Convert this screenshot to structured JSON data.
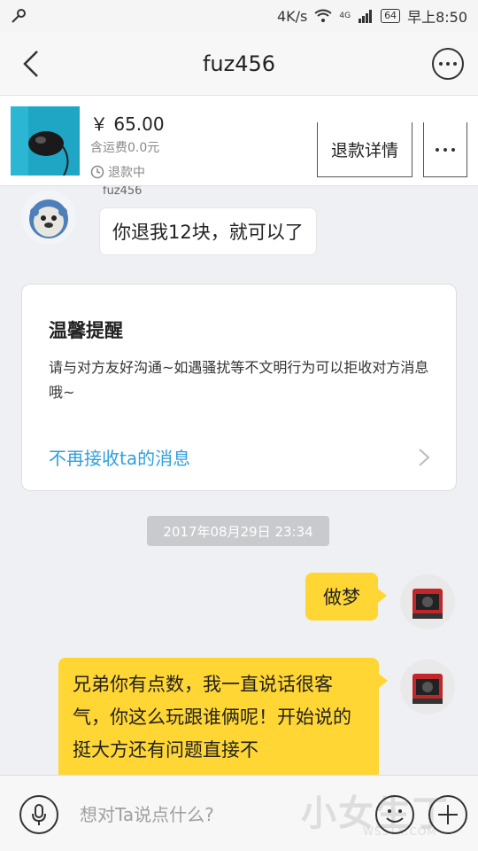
{
  "status_bar": {
    "network_speed": "4K/s",
    "signal_badge": "4G",
    "battery": "64",
    "time": "早上8:50"
  },
  "nav": {
    "title": "fuz456"
  },
  "product": {
    "price": "￥ 65.00",
    "shipping": "含运费0.0元",
    "status": "退款中",
    "refund_detail_label": "退款详情"
  },
  "chat": {
    "incoming_nickname": "fuz456",
    "incoming_message": "你退我12块，就可以了",
    "notice": {
      "title": "温馨提醒",
      "body": "请与对方友好沟通~如遇骚扰等不文明行为可以拒收对方消息哦~",
      "link": "不再接收ta的消息"
    },
    "timestamp": "2017年08月29日 23:34",
    "outgoing_messages": [
      "做梦",
      "兄弟你有点数，我一直说话很客气，你这么玩跟谁俩呢！开始说的挺大方还有问题直接不"
    ]
  },
  "input_bar": {
    "placeholder": "想对Ta说点什么?"
  },
  "watermark": {
    "text": "小女生丁",
    "sub": "WSSTX.COM"
  },
  "colors": {
    "outgoing_bubble": "#ffd633",
    "link": "#2e9fe0",
    "timestamp_bg": "#c8cacd"
  }
}
